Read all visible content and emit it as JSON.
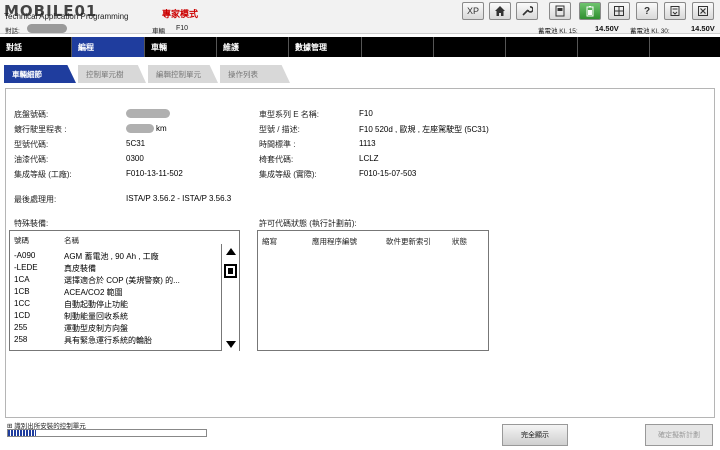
{
  "header": {
    "logo": "MOBILE01",
    "app_title": "Technical Application Programming",
    "mode": "專家模式",
    "vin_label": "對話:",
    "vehicle_label": "車輛",
    "vehicle_value": "F10",
    "voltage1_label": "蓄電池 Kl. 15:",
    "voltage1_value": "14.50V",
    "voltage2_label": "蓄電池 Kl. 30:",
    "voltage2_value": "14.50V",
    "toolbar": [
      "XP",
      "home-icon",
      "wrench-icon",
      "card-icon",
      "battery-icon",
      "grid-icon",
      "help-icon",
      "doc-icon",
      "close-icon"
    ]
  },
  "mainnav": {
    "items": [
      {
        "label": "對話"
      },
      {
        "label": "編程"
      },
      {
        "label": "車輛"
      },
      {
        "label": "維護"
      },
      {
        "label": "數據管理"
      },
      {
        "label": ""
      },
      {
        "label": ""
      },
      {
        "label": ""
      },
      {
        "label": ""
      },
      {
        "label": ""
      }
    ]
  },
  "subtabs": {
    "items": [
      {
        "label": "車輛細節"
      },
      {
        "label": "控制單元樹"
      },
      {
        "label": "編輯控制單元"
      },
      {
        "label": "操作列表"
      }
    ]
  },
  "details": {
    "chassis_label": "底盤號碼:",
    "mileage_label": "鍍行駛里程表 :",
    "mileage_unit": "km",
    "type_label": "型號代碼:",
    "type_value": "5C31",
    "paint_label": "油漆代碼:",
    "paint_value": "0300",
    "ilevel_label": "集成等級 (工廠):",
    "ilevel_value": "F010-13-11-502",
    "series_label": "車型系列 E 名稱:",
    "series_value": "F10",
    "model_label": "型號 / 描述:",
    "model_value": "F10 520d , 歐規 , 左座駕駛型 (5C31)",
    "time_label": "時間標準 :",
    "time_value": "1113",
    "upholstery_label": "椅套代碼:",
    "upholstery_value": "LCLZ",
    "ilevel_actual_label": "集成等級 (實際):",
    "ilevel_actual_value": "F010-15-07-503",
    "last_label": "最後處理用:",
    "last_value": "ISTA/P 3.56.2 - ISTA/P 3.56.3"
  },
  "equipment": {
    "title": "特殊裝備:",
    "col_code": "號碼",
    "col_name": "名稱",
    "rows": [
      {
        "code": "-A090",
        "name": "AGM 蓄電池 , 90 Ah , 工廠"
      },
      {
        "code": "-LEDE",
        "name": "真皮裝備"
      },
      {
        "code": "1CA",
        "name": "選擇適合於 COP (美規警察) 的..."
      },
      {
        "code": "1CB",
        "name": "ACEA/CO2 範圍"
      },
      {
        "code": "1CC",
        "name": "自動起動停止功能"
      },
      {
        "code": "1CD",
        "name": "制動能量回收系統"
      },
      {
        "code": "255",
        "name": "運動型皮制方向盤"
      },
      {
        "code": "258",
        "name": "具有緊急運行系統的輪胎"
      }
    ]
  },
  "license": {
    "title": "許可代碼狀態 (執行計劃前):",
    "cols": [
      "縮寫",
      "應用程序編號",
      "軟件更新索引",
      "狀態"
    ]
  },
  "footer": {
    "status": "識別出所安裝的控制單元",
    "progress": 0.14,
    "btn_full": "完全顯示",
    "btn_plan": "確定擬新計劃"
  }
}
